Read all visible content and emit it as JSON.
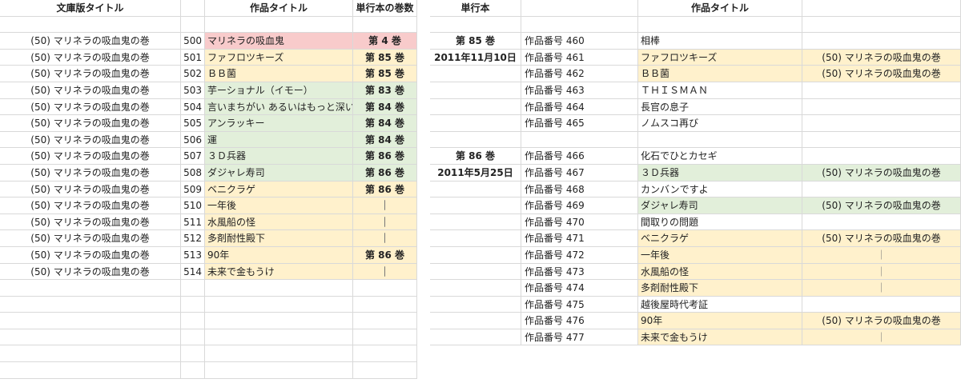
{
  "left": {
    "headers": {
      "bunko_title": "文庫版タイトル",
      "work_title": "作品タイトル",
      "volume_count": "単行本の巻数"
    },
    "rows": [
      {
        "bunko": "(50) マリネラの吸血鬼の巻",
        "no": "500",
        "title": "マリネラの吸血鬼",
        "vol": "第 4 巻",
        "color": "pink"
      },
      {
        "bunko": "(50) マリネラの吸血鬼の巻",
        "no": "501",
        "title": "ファフロツキーズ",
        "vol": "第 85 巻",
        "color": "yellow"
      },
      {
        "bunko": "(50) マリネラの吸血鬼の巻",
        "no": "502",
        "title": "ＢＢ菌",
        "vol": "第 85 巻",
        "color": "yellow"
      },
      {
        "bunko": "(50) マリネラの吸血鬼の巻",
        "no": "503",
        "title": "芋ーショナル（イモー）",
        "vol": "第 83 巻",
        "color": "green"
      },
      {
        "bunko": "(50) マリネラの吸血鬼の巻",
        "no": "504",
        "title": "言いまちがい あるいはもっと深い",
        "vol": "第 84 巻",
        "color": "green"
      },
      {
        "bunko": "(50) マリネラの吸血鬼の巻",
        "no": "505",
        "title": "アンラッキー",
        "vol": "第 84 巻",
        "color": "green"
      },
      {
        "bunko": "(50) マリネラの吸血鬼の巻",
        "no": "506",
        "title": "運",
        "vol": "第 84 巻",
        "color": "green"
      },
      {
        "bunko": "(50) マリネラの吸血鬼の巻",
        "no": "507",
        "title": "３Ｄ兵器",
        "vol": "第 86 巻",
        "color": "green"
      },
      {
        "bunko": "(50) マリネラの吸血鬼の巻",
        "no": "508",
        "title": "ダジャレ寿司",
        "vol": "第 86 巻",
        "color": "green"
      },
      {
        "bunko": "(50) マリネラの吸血鬼の巻",
        "no": "509",
        "title": "ベニクラゲ",
        "vol": "第 86 巻",
        "color": "yellow"
      },
      {
        "bunko": "(50) マリネラの吸血鬼の巻",
        "no": "510",
        "title": "一年後",
        "vol": "｜",
        "color": "yellow"
      },
      {
        "bunko": "(50) マリネラの吸血鬼の巻",
        "no": "511",
        "title": "水風船の怪",
        "vol": "｜",
        "color": "yellow"
      },
      {
        "bunko": "(50) マリネラの吸血鬼の巻",
        "no": "512",
        "title": "多剤耐性殿下",
        "vol": "｜",
        "color": "yellow"
      },
      {
        "bunko": "(50) マリネラの吸血鬼の巻",
        "no": "513",
        "title": "90年",
        "vol": "第 86 巻",
        "color": "yellow"
      },
      {
        "bunko": "(50) マリネラの吸血鬼の巻",
        "no": "514",
        "title": "未来で金もうけ",
        "vol": "｜",
        "color": "yellow"
      }
    ]
  },
  "right": {
    "headers": {
      "volume": "単行本",
      "work_title": "作品タイトル"
    },
    "rows": [
      {
        "vol": "第 85 巻",
        "num": "作品番号 460",
        "title": "相棒",
        "bunko": "",
        "color": ""
      },
      {
        "vol": "2011年11月10日",
        "num": "作品番号 461",
        "title": "ファフロツキーズ",
        "bunko": "(50) マリネラの吸血鬼の巻",
        "color": "yellow"
      },
      {
        "vol": "",
        "num": "作品番号 462",
        "title": "ＢＢ菌",
        "bunko": "(50) マリネラの吸血鬼の巻",
        "color": "yellow"
      },
      {
        "vol": "",
        "num": "作品番号 463",
        "title": "ＴＨＩＳＭＡＮ",
        "bunko": "",
        "color": ""
      },
      {
        "vol": "",
        "num": "作品番号 464",
        "title": "長官の息子",
        "bunko": "",
        "color": ""
      },
      {
        "vol": "",
        "num": "作品番号 465",
        "title": "ノムスコ再び",
        "bunko": "",
        "color": ""
      },
      {
        "vol": "",
        "num": "",
        "title": "",
        "bunko": "",
        "color": ""
      },
      {
        "vol": "第 86 巻",
        "num": "作品番号 466",
        "title": "化石でひとカセギ",
        "bunko": "",
        "color": ""
      },
      {
        "vol": "2011年5月25日",
        "num": "作品番号 467",
        "title": "３Ｄ兵器",
        "bunko": "(50) マリネラの吸血鬼の巻",
        "color": "green"
      },
      {
        "vol": "",
        "num": "作品番号 468",
        "title": "カンバンですよ",
        "bunko": "",
        "color": ""
      },
      {
        "vol": "",
        "num": "作品番号 469",
        "title": "ダジャレ寿司",
        "bunko": "(50) マリネラの吸血鬼の巻",
        "color": "green"
      },
      {
        "vol": "",
        "num": "作品番号 470",
        "title": "間取りの問題",
        "bunko": "",
        "color": ""
      },
      {
        "vol": "",
        "num": "作品番号 471",
        "title": "ベニクラゲ",
        "bunko": "(50) マリネラの吸血鬼の巻",
        "color": "yellow"
      },
      {
        "vol": "",
        "num": "作品番号 472",
        "title": "一年後",
        "bunko": "｜",
        "color": "yellow"
      },
      {
        "vol": "",
        "num": "作品番号 473",
        "title": "水風船の怪",
        "bunko": "｜",
        "color": "yellow"
      },
      {
        "vol": "",
        "num": "作品番号 474",
        "title": "多剤耐性殿下",
        "bunko": "｜",
        "color": "yellow"
      },
      {
        "vol": "",
        "num": "作品番号 475",
        "title": "越後屋時代考証",
        "bunko": "",
        "color": ""
      },
      {
        "vol": "",
        "num": "作品番号 476",
        "title": "90年",
        "bunko": "(50) マリネラの吸血鬼の巻",
        "color": "yellow"
      },
      {
        "vol": "",
        "num": "作品番号 477",
        "title": "未来で金もうけ",
        "bunko": "｜",
        "color": "yellow"
      }
    ]
  },
  "colors": {
    "pink": "#f8cbcb",
    "yellow": "#fff1cc",
    "green": "#e2efda",
    "grid": "#d9d9d9"
  }
}
